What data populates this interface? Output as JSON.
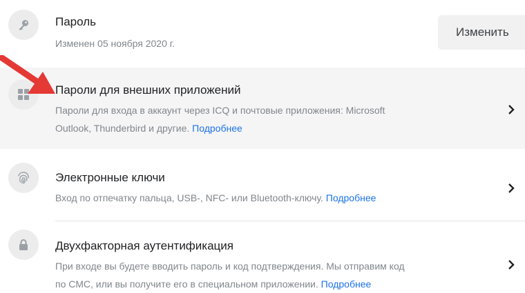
{
  "password": {
    "title": "Пароль",
    "subtitle": "Изменен 05 ноября 2020 г.",
    "button_label": "Изменить",
    "icon": "key-icon"
  },
  "app_passwords": {
    "title": "Пароли для внешних приложений",
    "desc_line1": "Пароли для входа в аккаунт через ICQ и почтовые приложения: Microsoft",
    "desc_line2": "Outlook, Thunderbird и другие.",
    "link": "Подробнее",
    "icon": "apps-grid-icon"
  },
  "security_keys": {
    "title": "Электронные ключи",
    "desc_line1": "Вход по отпечатку пальца, USB-, NFC- или Bluetooth-ключу.",
    "link": "Подробнее",
    "icon": "fingerprint-icon"
  },
  "two_factor": {
    "title": "Двухфакторная аутентификация",
    "desc_line1": "При входе вы будете вводить пароль и код подтверждения. Мы отправим код",
    "desc_line2": "по СМС, или вы получите его в специальном приложении.",
    "link": "Подробнее",
    "icon": "lock-icon"
  },
  "colors": {
    "link": "#1a73e8",
    "highlight_bg": "#f5f5f6",
    "annotation_arrow": "#e53935"
  }
}
